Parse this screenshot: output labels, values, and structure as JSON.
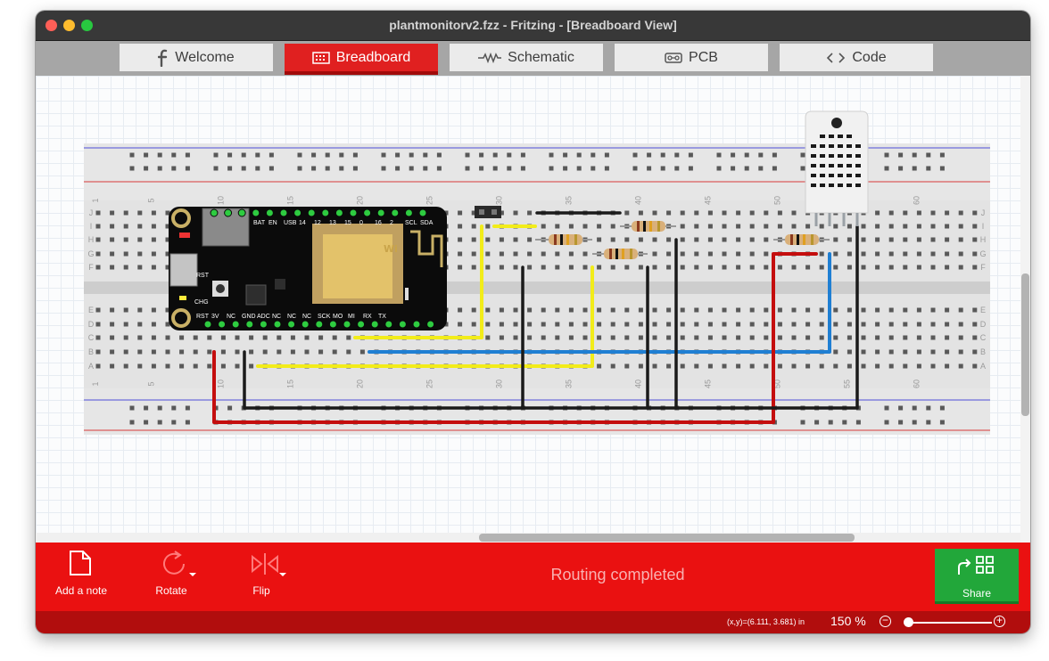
{
  "window": {
    "title": "plantmonitorv2.fzz - Fritzing - [Breadboard View]"
  },
  "tabs": [
    {
      "label": "Welcome",
      "icon": "fritzing-f-icon",
      "active": false
    },
    {
      "label": "Breadboard",
      "icon": "breadboard-icon",
      "active": true
    },
    {
      "label": "Schematic",
      "icon": "resistor-symbol-icon",
      "active": false
    },
    {
      "label": "PCB",
      "icon": "pcb-icon",
      "active": false
    },
    {
      "label": "Code",
      "icon": "code-brackets-icon",
      "active": false
    }
  ],
  "canvas": {
    "logo": "fritzing",
    "breadboard": {
      "row_labels": [
        "J",
        "I",
        "H",
        "G",
        "F",
        "E",
        "D",
        "C",
        "B",
        "A"
      ],
      "column_numbers": [
        "1",
        "5",
        "10",
        "15",
        "20",
        "25",
        "30",
        "35",
        "40",
        "45",
        "50",
        "55",
        "60"
      ]
    },
    "feather_board": {
      "top_pins": [
        "BAT",
        "EN",
        "USB",
        "14",
        "12",
        "13",
        "15",
        "0",
        "16",
        "2",
        "SCL",
        "SDA"
      ],
      "bottom_pins": [
        "RST",
        "3V",
        "NC",
        "GND",
        "ADC",
        "NC",
        "NC",
        "NC",
        "SCK",
        "MO",
        "MI",
        "RX",
        "TX"
      ],
      "side_labels": [
        "CHG",
        "RST"
      ]
    },
    "wire_colors": {
      "yellow": "#f2ec1a",
      "blue": "#1f7fd3",
      "red": "#c40e0e",
      "black": "#1a1a1a"
    }
  },
  "toolbar": {
    "add_note": "Add a note",
    "rotate": "Rotate",
    "flip": "Flip",
    "status": "Routing completed",
    "share": "Share"
  },
  "statusbar": {
    "coords": "(x,y)=(6.111, 3.681) in",
    "zoom": "150",
    "zoom_unit": "%"
  },
  "colors": {
    "toolbar_red": "#ea1111",
    "share_green": "#22a73a",
    "active_tab": "#e02020"
  }
}
